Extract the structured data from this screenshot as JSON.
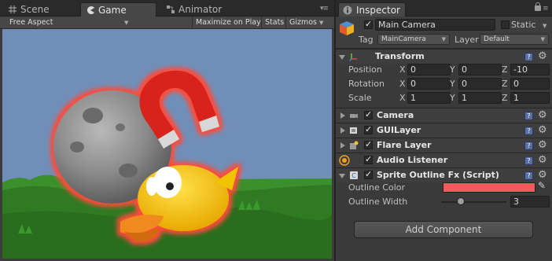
{
  "tabs": {
    "scene": "Scene",
    "game": "Game",
    "animator": "Animator"
  },
  "gamebar": {
    "aspect": "Free Aspect",
    "maximize": "Maximize on Play",
    "stats": "Stats",
    "gizmos": "Gizmos"
  },
  "inspector": {
    "tab": "Inspector",
    "object_name": "Main Camera",
    "static_label": "Static",
    "tag_label": "Tag",
    "tag_value": "MainCamera",
    "layer_label": "Layer",
    "layer_value": "Default"
  },
  "transform": {
    "title": "Transform",
    "position_label": "Position",
    "rotation_label": "Rotation",
    "scale_label": "Scale",
    "axis": {
      "x": "X",
      "y": "Y",
      "z": "Z"
    },
    "position": {
      "x": "0",
      "y": "0",
      "z": "-10"
    },
    "rotation": {
      "x": "0",
      "y": "0",
      "z": "0"
    },
    "scale": {
      "x": "1",
      "y": "1",
      "z": "1"
    }
  },
  "components": {
    "camera": "Camera",
    "guilayer": "GUILayer",
    "flare": "Flare Layer",
    "audio": "Audio Listener",
    "sprite": "Sprite Outline Fx (Script)"
  },
  "sprite_fx": {
    "outline_color_label": "Outline Color",
    "outline_color": "#f05a5a",
    "outline_width_label": "Outline Width",
    "outline_width": "3",
    "outline_width_fraction": 0.3
  },
  "add_component": "Add Component"
}
